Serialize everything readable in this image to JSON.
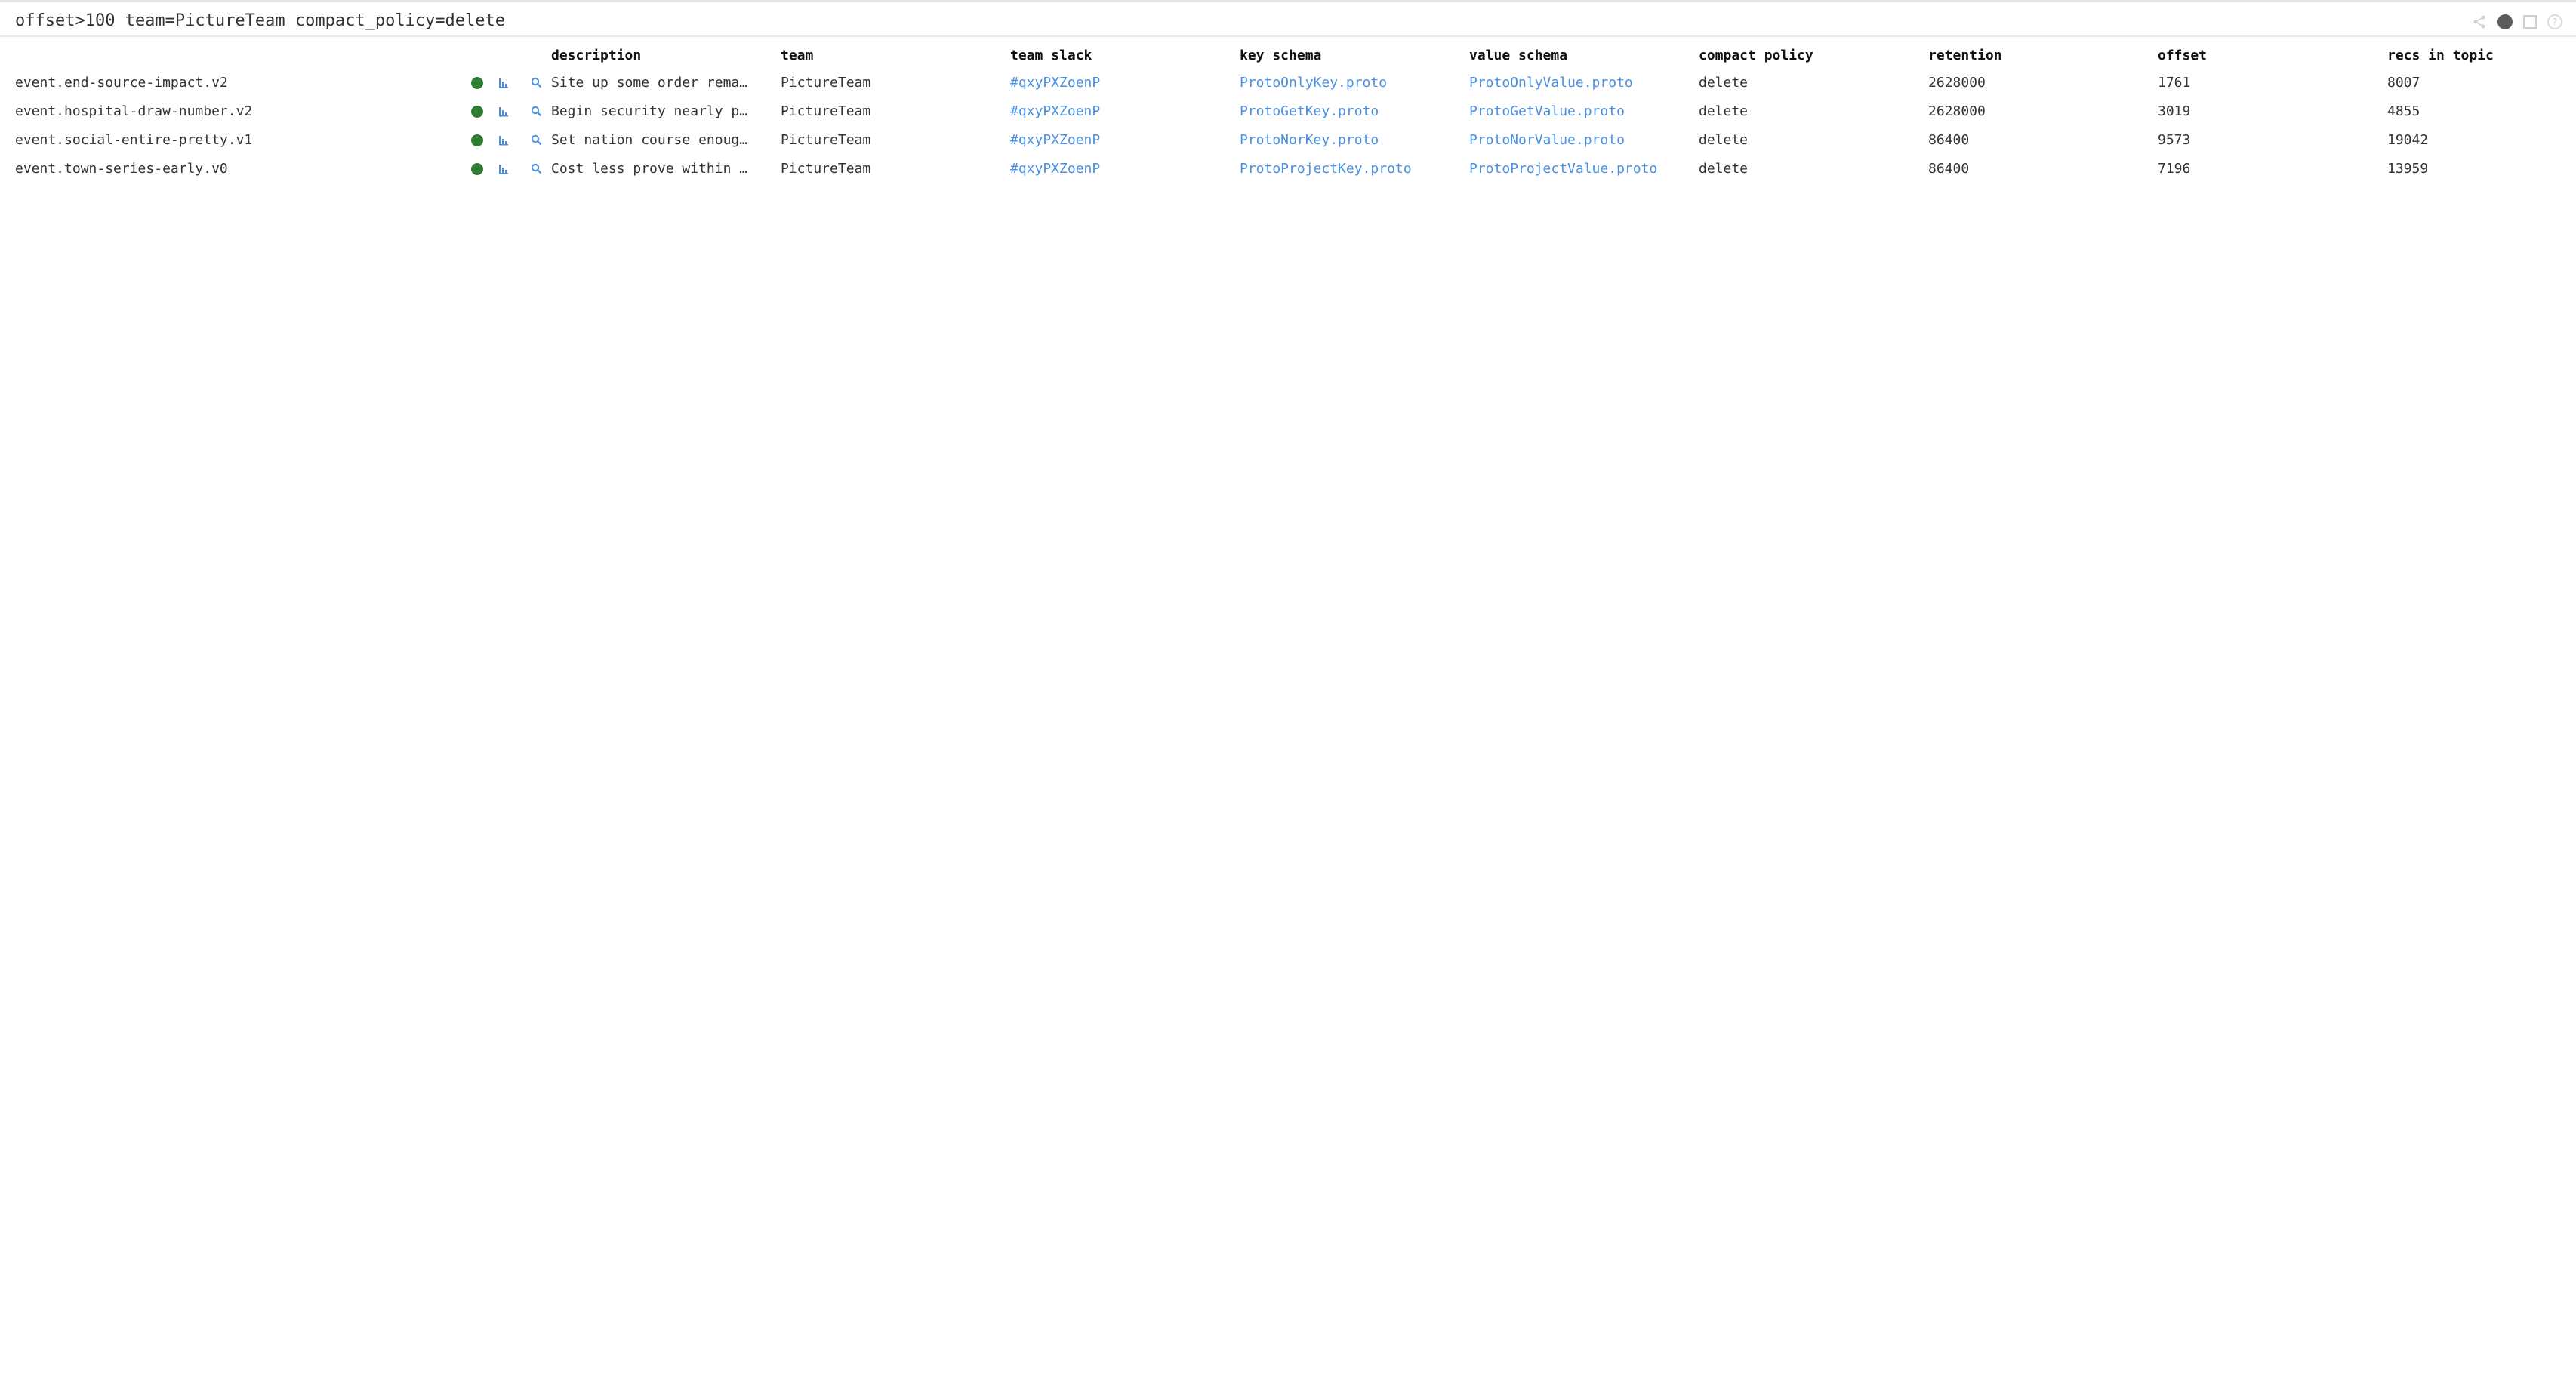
{
  "query": "offset>100 team=PictureTeam compact_policy=delete",
  "toolbar": {
    "icons": [
      "share-icon",
      "status-dot-icon",
      "square-icon",
      "help-icon"
    ],
    "help_glyph": "?"
  },
  "columns": {
    "description": "description",
    "team": "team",
    "team_slack": "team slack",
    "key_schema": "key schema",
    "value_schema": "value schema",
    "compact_policy": "compact policy",
    "retention": "retention",
    "offset": "offset",
    "recs_in_topic": "recs in topic"
  },
  "colors": {
    "status_ok": "#2e7d32",
    "link": "#4a90e2",
    "icon": "#4a90e2"
  },
  "rows": [
    {
      "name": "event.end-source-impact.v2",
      "description": "Site up some order rema…",
      "team": "PictureTeam",
      "team_slack": "#qxyPXZoenP",
      "key_schema": "ProtoOnlyKey.proto",
      "value_schema": "ProtoOnlyValue.proto",
      "compact_policy": "delete",
      "retention": "2628000",
      "offset": "1761",
      "recs_in_topic": "8007"
    },
    {
      "name": "event.hospital-draw-number.v2",
      "description": "Begin security nearly p…",
      "team": "PictureTeam",
      "team_slack": "#qxyPXZoenP",
      "key_schema": "ProtoGetKey.proto",
      "value_schema": "ProtoGetValue.proto",
      "compact_policy": "delete",
      "retention": "2628000",
      "offset": "3019",
      "recs_in_topic": "4855"
    },
    {
      "name": "event.social-entire-pretty.v1",
      "description": "Set nation course enoug…",
      "team": "PictureTeam",
      "team_slack": "#qxyPXZoenP",
      "key_schema": "ProtoNorKey.proto",
      "value_schema": "ProtoNorValue.proto",
      "compact_policy": "delete",
      "retention": "86400",
      "offset": "9573",
      "recs_in_topic": "19042"
    },
    {
      "name": "event.town-series-early.v0",
      "description": "Cost less prove within …",
      "team": "PictureTeam",
      "team_slack": "#qxyPXZoenP",
      "key_schema": "ProtoProjectKey.proto",
      "value_schema": "ProtoProjectValue.proto",
      "compact_policy": "delete",
      "retention": "86400",
      "offset": "7196",
      "recs_in_topic": "13959"
    }
  ]
}
